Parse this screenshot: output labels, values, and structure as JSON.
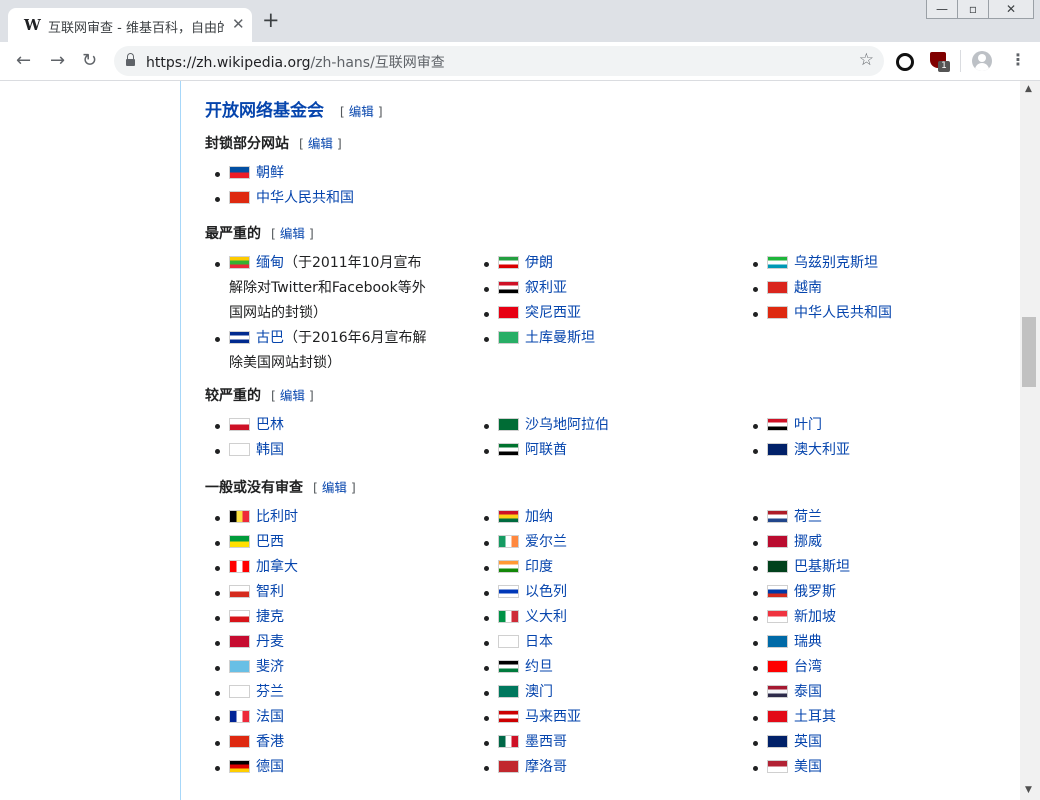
{
  "browser": {
    "tab_title": "互联网审查 - 维基百科，自由的百科全书",
    "tab_icon": "W",
    "url_host": "https://zh.wikipedia.org",
    "url_path": "/zh-hans/互联网审查",
    "ext_badge": "1"
  },
  "page": {
    "heading": "开放网络基金会",
    "edit_label": "编辑",
    "sections": [
      {
        "title": "封锁部分网站",
        "columns": [
          [
            {
              "name": "朝鲜",
              "flag": [
                "#024fa2",
                "#ed1c27"
              ]
            },
            {
              "name": "中华人民共和国",
              "flag": [
                "#de2910",
                "#de2910"
              ]
            }
          ]
        ]
      },
      {
        "title": "最严重的",
        "columns": [
          [
            {
              "name": "缅甸",
              "note": "（于2011年10月宣布解除对Twitter和Facebook等外国网站的封锁）",
              "flag": [
                "#fecb00",
                "#34b233",
                "#ea2839"
              ]
            },
            {
              "name": "古巴",
              "note": "（于2016年6月宣布解除美国网站封锁）",
              "flag": [
                "#002a8f",
                "#ffffff",
                "#002a8f"
              ]
            }
          ],
          [
            {
              "name": "伊朗",
              "flag": [
                "#239f40",
                "#ffffff",
                "#da0000"
              ]
            },
            {
              "name": "叙利亚",
              "flag": [
                "#ce1126",
                "#ffffff",
                "#000000"
              ]
            },
            {
              "name": "突尼西亚",
              "flag": [
                "#e70013",
                "#e70013"
              ]
            },
            {
              "name": "土库曼斯坦",
              "flag": [
                "#28ae66",
                "#28ae66"
              ]
            }
          ],
          [
            {
              "name": "乌兹别克斯坦",
              "flag": [
                "#1eb53a",
                "#ffffff",
                "#0099b5"
              ]
            },
            {
              "name": "越南",
              "flag": [
                "#da251d",
                "#da251d"
              ]
            },
            {
              "name": "中华人民共和国",
              "flag": [
                "#de2910",
                "#de2910"
              ]
            }
          ]
        ]
      },
      {
        "title": "较严重的",
        "columns": [
          [
            {
              "name": "巴林",
              "flag": [
                "#ffffff",
                "#ce1126"
              ]
            },
            {
              "name": "韩国",
              "flag": [
                "#ffffff",
                "#ffffff"
              ]
            }
          ],
          [
            {
              "name": "沙乌地阿拉伯",
              "flag": [
                "#006c35",
                "#006c35"
              ]
            },
            {
              "name": "阿联酋",
              "flag": [
                "#00732f",
                "#ffffff",
                "#000000"
              ]
            }
          ],
          [
            {
              "name": "叶门",
              "flag": [
                "#ce1126",
                "#ffffff",
                "#000000"
              ]
            },
            {
              "name": "澳大利亚",
              "flag": [
                "#012169",
                "#012169"
              ]
            }
          ]
        ]
      },
      {
        "title": "一般或没有审查",
        "columns": [
          [
            {
              "name": "比利时",
              "flag": [
                "#000000",
                "#fae042",
                "#ed2939"
              ],
              "vertical": true
            },
            {
              "name": "巴西",
              "flag": [
                "#009c3b",
                "#ffdf00"
              ]
            },
            {
              "name": "加拿大",
              "flag": [
                "#ff0000",
                "#ffffff",
                "#ff0000"
              ],
              "vertical": true
            },
            {
              "name": "智利",
              "flag": [
                "#ffffff",
                "#d52b1e"
              ]
            },
            {
              "name": "捷克",
              "flag": [
                "#ffffff",
                "#d7141a"
              ]
            },
            {
              "name": "丹麦",
              "flag": [
                "#c60c30",
                "#c60c30"
              ]
            },
            {
              "name": "斐济",
              "flag": [
                "#68bfe5",
                "#68bfe5"
              ]
            },
            {
              "name": "芬兰",
              "flag": [
                "#ffffff",
                "#ffffff"
              ]
            },
            {
              "name": "法国",
              "flag": [
                "#002395",
                "#ffffff",
                "#ed2939"
              ],
              "vertical": true
            },
            {
              "name": "香港",
              "flag": [
                "#de2910",
                "#de2910"
              ]
            },
            {
              "name": "德国",
              "flag": [
                "#000000",
                "#dd0000",
                "#ffce00"
              ]
            }
          ],
          [
            {
              "name": "加纳",
              "flag": [
                "#ce1126",
                "#fcd116",
                "#006b3f"
              ]
            },
            {
              "name": "爱尔兰",
              "flag": [
                "#169b62",
                "#ffffff",
                "#ff883e"
              ],
              "vertical": true
            },
            {
              "name": "印度",
              "flag": [
                "#ff9933",
                "#ffffff",
                "#138808"
              ]
            },
            {
              "name": "以色列",
              "flag": [
                "#ffffff",
                "#0038b8",
                "#ffffff"
              ]
            },
            {
              "name": "义大利",
              "flag": [
                "#009246",
                "#ffffff",
                "#ce2b37"
              ],
              "vertical": true
            },
            {
              "name": "日本",
              "flag": [
                "#ffffff",
                "#ffffff"
              ]
            },
            {
              "name": "约旦",
              "flag": [
                "#000000",
                "#ffffff",
                "#007a3d"
              ]
            },
            {
              "name": "澳门",
              "flag": [
                "#00785e",
                "#00785e"
              ]
            },
            {
              "name": "马来西亚",
              "flag": [
                "#cc0001",
                "#ffffff",
                "#cc0001"
              ]
            },
            {
              "name": "墨西哥",
              "flag": [
                "#006847",
                "#ffffff",
                "#ce1126"
              ],
              "vertical": true
            },
            {
              "name": "摩洛哥",
              "flag": [
                "#c1272d",
                "#c1272d"
              ]
            }
          ],
          [
            {
              "name": "荷兰",
              "flag": [
                "#ae1c28",
                "#ffffff",
                "#21468b"
              ]
            },
            {
              "name": "挪威",
              "flag": [
                "#ba0c2f",
                "#ba0c2f"
              ]
            },
            {
              "name": "巴基斯坦",
              "flag": [
                "#01411c",
                "#01411c"
              ]
            },
            {
              "name": "俄罗斯",
              "flag": [
                "#ffffff",
                "#0039a6",
                "#d52b1e"
              ]
            },
            {
              "name": "新加坡",
              "flag": [
                "#ef3340",
                "#ffffff"
              ]
            },
            {
              "name": "瑞典",
              "flag": [
                "#006aa7",
                "#006aa7"
              ]
            },
            {
              "name": "台湾",
              "flag": [
                "#fe0000",
                "#fe0000"
              ]
            },
            {
              "name": "泰国",
              "flag": [
                "#a51931",
                "#f4f5f8",
                "#2d2a4a"
              ]
            },
            {
              "name": "土耳其",
              "flag": [
                "#e30a17",
                "#e30a17"
              ]
            },
            {
              "name": "英国",
              "flag": [
                "#012169",
                "#012169"
              ]
            },
            {
              "name": "美国",
              "flag": [
                "#b22234",
                "#ffffff"
              ]
            }
          ]
        ]
      }
    ]
  }
}
